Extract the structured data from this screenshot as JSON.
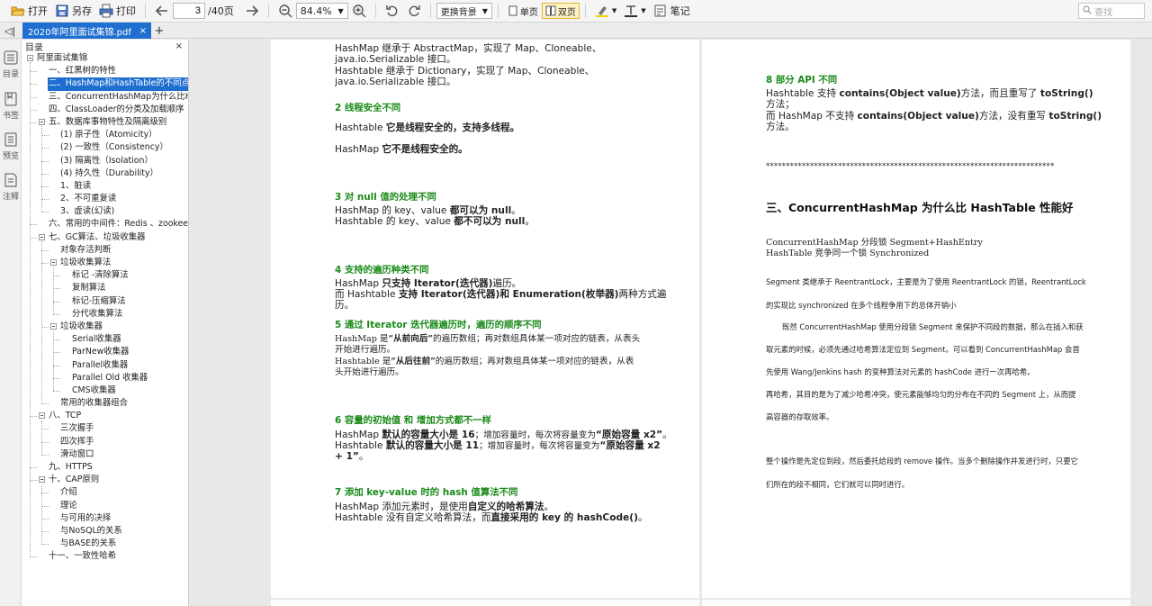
{
  "toolbar": {
    "open": "打开",
    "save_as": "另存",
    "print": "打印",
    "page_current": "3",
    "page_total": "/40页",
    "zoom": "84.4%",
    "background": "更换背景",
    "single_page": "单页",
    "double_page": "双页",
    "note": "笔记",
    "search_placeholder": "查找"
  },
  "tabs": {
    "document": "2020年阿里面试集锦.pdf",
    "close": "×",
    "add": "+"
  },
  "rail": [
    "目录",
    "书签",
    "预览",
    "注释"
  ],
  "outline": {
    "title": "目录",
    "close": "×",
    "nodes": [
      "阿里面试集锦",
      "一、红黑树的特性",
      "二、HashMap和HashTable的不同点",
      "三、ConcurrentHashMap为什么比Hash",
      "四、ClassLoader的分类及加载顺序",
      "五、数据库事物特性及隔离级别",
      "(1) 原子性（Atomicity）",
      "(2) 一致性（Consistency）",
      "(3) 隔离性（Isolation）",
      "(4) 持久性（Durability）",
      "1、脏读",
      "2、不可重复读",
      "3、虚读(幻读)",
      "六、常用的中间件：Redis 、zookeeper",
      "七、GC算法、垃圾收集器",
      "对象存活判断",
      "垃圾收集算法",
      "标记 -清除算法",
      "复制算法",
      "标记-压缩算法",
      "分代收集算法",
      "垃圾收集器",
      "Serial收集器",
      "ParNew收集器",
      "Parallel收集器",
      "Parallel Old 收集器",
      "CMS收集器",
      "常用的收集器组合",
      "八、TCP",
      "三次握手",
      "四次挥手",
      "滑动窗口",
      "九、HTTPS",
      "十、CAP原则",
      "介绍",
      "理论",
      "与可用的决择",
      "与NoSQL的关系",
      "与BASE的关系",
      "十一、一致性哈希"
    ]
  },
  "page1": {
    "l1": "HashMap 继承于 AbstractMap，实现了 Map、Cloneable、",
    "l2": "java.io.Serializable 接口。",
    "l3": "Hashtable 继承于 Dictionary，实现了 Map、Cloneable、",
    "l4": "java.io.Serializable 接口。",
    "h2": "2 线程安全不同",
    "s2a_pre": "Hashtable ",
    "s2a_b": "它是线程安全的，支持多线程。",
    "s2b_pre": "HashMap ",
    "s2b_b": "它不是线程安全的。",
    "h3": "3 对 null 值的处理不同",
    "s3a_pre": "HashMap 的 key、value ",
    "s3a_b": "都可以为 null",
    "s3a_post": "。",
    "s3b_pre": "Hashtable 的 key、value ",
    "s3b_b": "都不可以为 null",
    "s3b_post": "。",
    "h4": "4 支持的遍历种类不同",
    "s4a_pre": "HashMap ",
    "s4a_b": "只支持 Iterator(迭代器)",
    "s4a_post": "遍历。",
    "s4b_pre": "而 Hashtable ",
    "s4b_b": "支持 Iterator(迭代器)和 Enumeration(枚举器)",
    "s4b_post": "两种方式遍",
    "s4c": "历。",
    "h5": "5 通过 Iterator 迭代器遍历时，遍历的顺序不同",
    "s5a_pre": "HashMap 是",
    "s5a_b": "“从前向后”",
    "s5a_post": "的遍历数组；再对数组具体某一项对应的链表，从表头",
    "s5b": "开始进行遍历。",
    "s5c_pre": "Hashtable 是",
    "s5c_b": "“从后往前”",
    "s5c_post": "的遍历数组；再对数组具体某一项对应的链表，从表",
    "s5d": "头开始进行遍历。",
    "h6": "6 容量的初始值 和 增加方式都不一样",
    "s6a_pre": "HashMap ",
    "s6a_b": "默认的容量大小是 16",
    "s6a_post": "；增加容量时，每次将容量变为",
    "s6a_b2": "“原始容量 x2”",
    "s6a_end": "。",
    "s6b_pre": "Hashtable ",
    "s6b_b": "默认的容量大小是 11",
    "s6b_post": "；增加容量时，每次将容量变为",
    "s6b_b2": "“原始容量 x2",
    "s6c_b": "+ 1”",
    "s6c_post": "。",
    "h7": "7 添加 key-value 时的 hash 值算法不同",
    "s7a_pre": "HashMap 添加元素时，是使用",
    "s7a_b": "自定义的哈希算法",
    "s7a_post": "。",
    "s7b_pre": "Hashtable 没有自定义哈希算法，而",
    "s7b_b": "直接采用的 key 的 hashCode()",
    "s7b_post": "。"
  },
  "page2": {
    "h8": "8 部分 API 不同",
    "s8a_pre": "Hashtable 支持 ",
    "s8a_b": "contains(Object value)",
    "s8a_mid": "方法，而且重写了 ",
    "s8a_b2": "toString()",
    "s8b": "方法；",
    "s8c_pre": "而 HashMap 不支持 ",
    "s8c_b": "contains(Object value)",
    "s8c_mid": "方法，没有重写 ",
    "s8c_b2": "toString()",
    "s8d": "方法。",
    "stars": "************************************************************************",
    "title3": "三、ConcurrentHashMap 为什么比 HashTable 性能好",
    "c1": "ConcurrentHashMap   分段锁  Segment+HashEntry",
    "c2": "HashTable 竞争同一个锁  Synchronized",
    "c3": "Segment 类继承于 ReentrantLock，主要是为了使用 ReentrantLock 的锁，ReentrantLock",
    "c4": "的实现比  synchronized 在多个线程争用下的总体开销小",
    "c5": "既然 ConcurrentHashMap 使用分段锁 Segment 来保护不同段的数据，那么在插入和获",
    "c6": "取元素的时候，必须先通过哈希算法定位到 Segment。可以看到 ConcurrentHashMap 会首",
    "c7": "先使用 Wang/Jenkins hash 的变种算法对元素的 hashCode 进行一次再哈希。",
    "c8": "再哈希，其目的是为了减少哈希冲突，使元素能够均匀的分布在不同的 Segment 上，从而提",
    "c9": "高容器的存取效率。",
    "c10": "整个操作是先定位到段，然后委托给段的 remove 操作。当多个删除操作并发进行时，只要它",
    "c11": "们所在的段不相同，它们就可以同时进行。"
  }
}
